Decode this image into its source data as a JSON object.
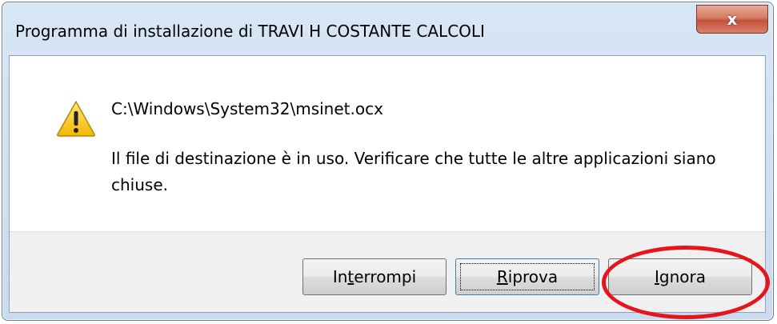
{
  "window": {
    "title": "Programma di installazione di TRAVI H COSTANTE CALCOLI",
    "close_glyph": "x",
    "icons": {
      "close": "close-icon",
      "warning": "warning-icon"
    }
  },
  "message": {
    "path": "C:\\Windows\\System32\\msinet.ocx",
    "text": "Il file di destinazione è in uso. Verificare che tutte le altre applicazioni siano chiuse."
  },
  "buttons": {
    "abort": {
      "pre": "In",
      "accel": "t",
      "post": "errompi"
    },
    "retry": {
      "pre": "",
      "accel": "R",
      "post": "iprova"
    },
    "ignore": {
      "pre": "",
      "accel": "I",
      "post": "gnora"
    }
  },
  "colors": {
    "highlight_ellipse": "#e8141c",
    "close_button": "#c4513a",
    "warning_triangle": "#f5c400"
  }
}
